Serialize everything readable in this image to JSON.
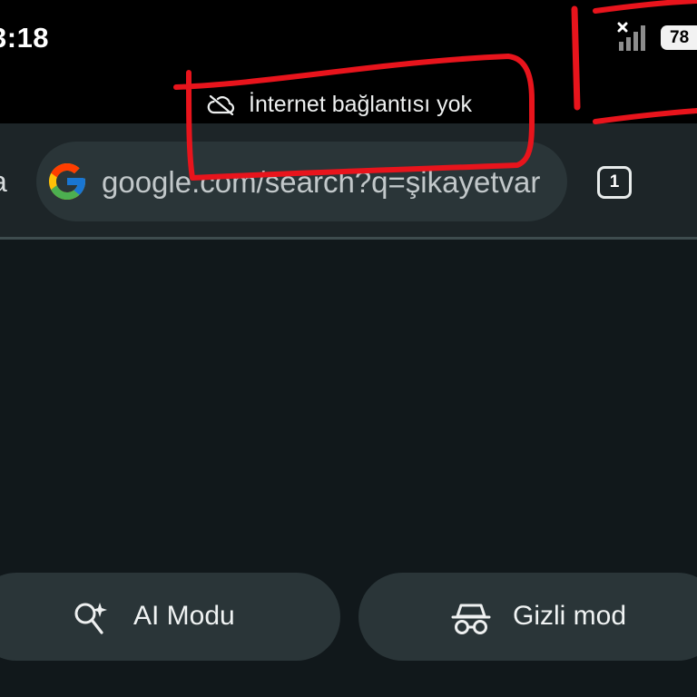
{
  "status_bar": {
    "time": "3:18",
    "battery": "78",
    "signal_icon": "signal-no-service-icon"
  },
  "offline_banner": {
    "text": "İnternet bağlantısı yok",
    "icon": "cloud-off-icon"
  },
  "toolbar": {
    "edge_fragment": "a",
    "url": "google.com/search?q=şikayetvar",
    "tab_count": "1"
  },
  "actions": {
    "ai_mode_label": "AI Modu",
    "incognito_label": "Gizli mod"
  },
  "colors": {
    "background": "#11181b",
    "toolbar": "#1d2528",
    "pill": "#2a3538",
    "annotation": "#e8141c"
  }
}
